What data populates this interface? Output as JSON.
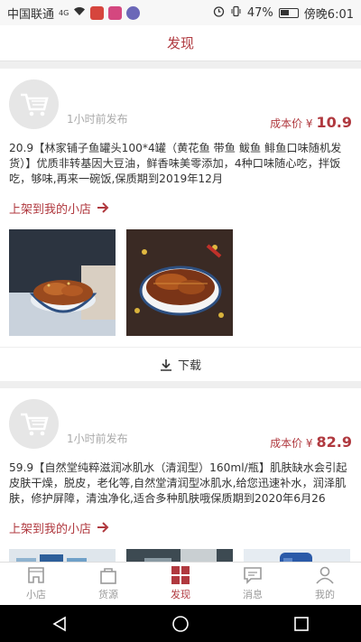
{
  "status_bar": {
    "carrier": "中国联通",
    "network": "4G",
    "battery": "47%",
    "time": "傍晚6:01"
  },
  "header": {
    "title": "发现"
  },
  "posts": [
    {
      "post_time": "1小时前发布",
      "price_label": "成本价 ¥",
      "price": "10.9",
      "description": "20.9【林家铺子鱼罐头100*4罐（黄花鱼 带鱼 鲅鱼 鲱鱼口味随机发货）】优质非转基因大豆油，鲜香味美零添加，4种口味随心吃，拌饭吃，够味,再来一碗饭,保质期到2019年12月",
      "shelf_link": "上架到我的小店",
      "download": "下载"
    },
    {
      "post_time": "1小时前发布",
      "price_label": "成本价 ¥",
      "price": "82.9",
      "description": "59.9【自然堂纯粹滋润冰肌水（清润型）160ml/瓶】肌肤缺水会引起皮肤干燥，脱皮，老化等,自然堂清润型冰肌水,给您迅速补水，润泽肌肤，修护屏障，清浊净化,适合多种肌肤哦保质期到2020年6月26",
      "shelf_link": "上架到我的小店"
    }
  ],
  "tabs": [
    {
      "label": "小店",
      "icon": "shop-icon"
    },
    {
      "label": "货源",
      "icon": "bag-icon"
    },
    {
      "label": "发现",
      "icon": "grid-icon"
    },
    {
      "label": "消息",
      "icon": "message-icon"
    },
    {
      "label": "我的",
      "icon": "person-icon"
    }
  ],
  "colors": {
    "accent": "#b0393f",
    "inactive": "#9a9a9a"
  }
}
